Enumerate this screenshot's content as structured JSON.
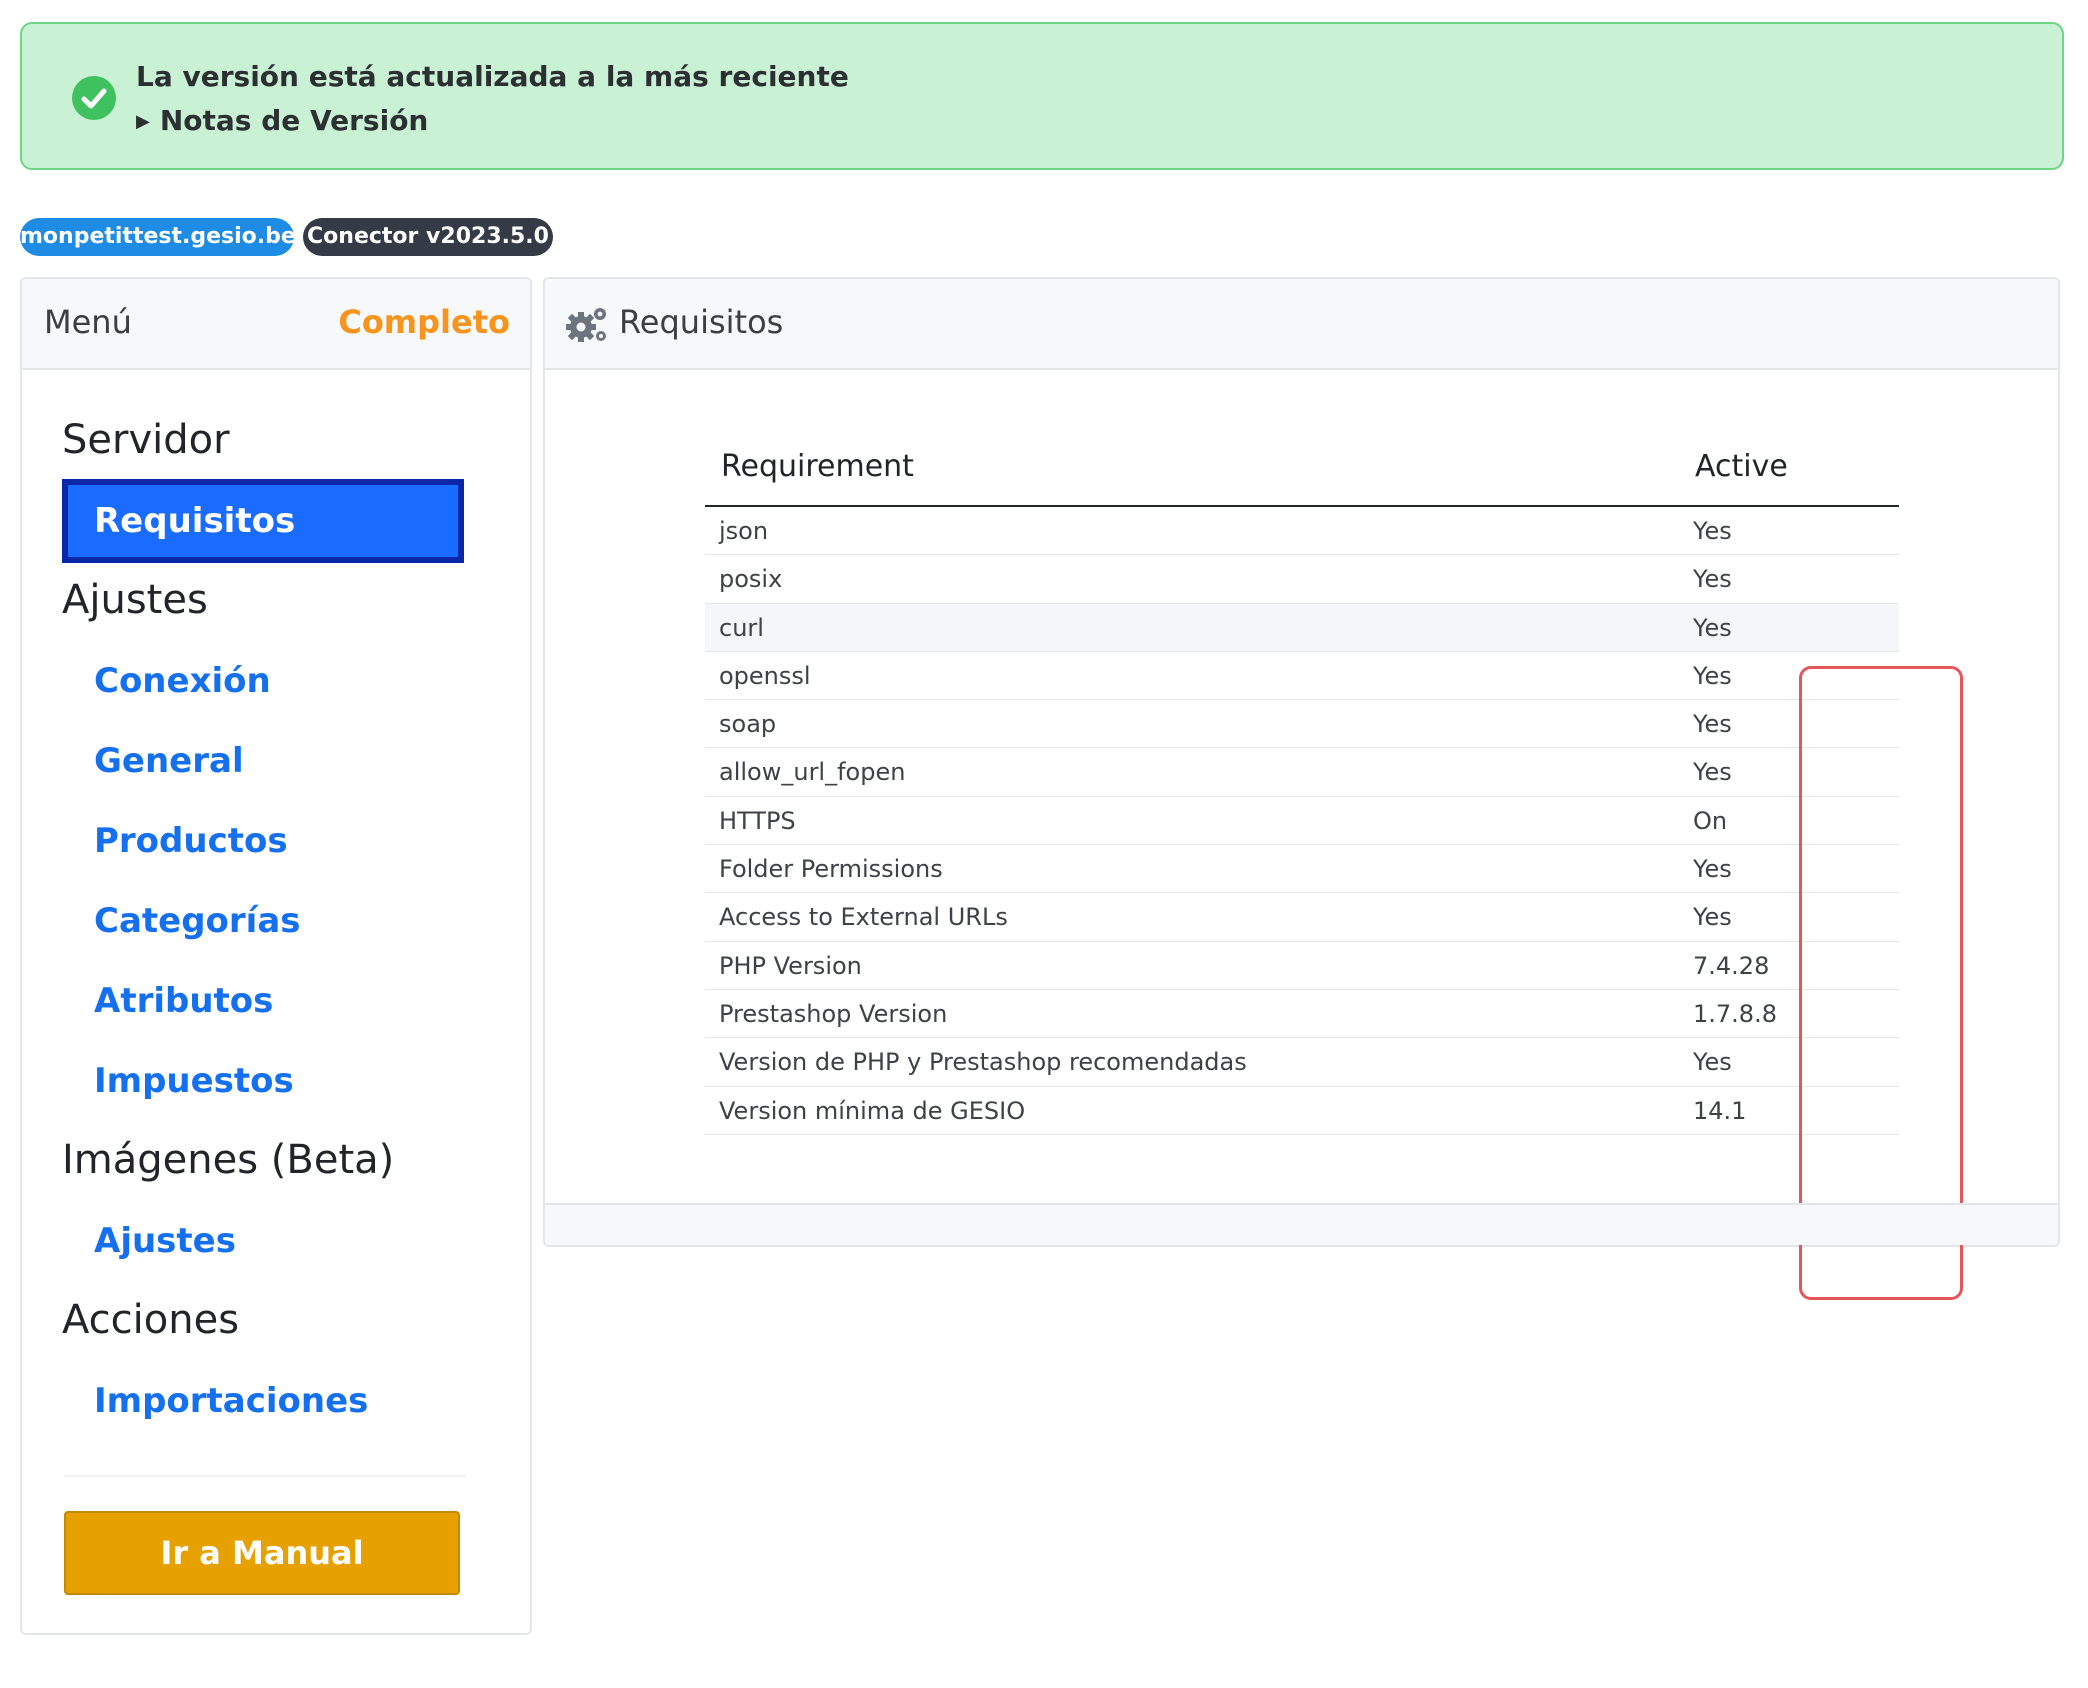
{
  "alert": {
    "message": "La versión está actualizada a la más reciente",
    "notes_label": "Notas de Versión",
    "color": "#c9f1d4"
  },
  "badges": {
    "site": "monpetittest.gesio.be",
    "version": "Conector v2023.5.0"
  },
  "sidebar": {
    "title": "Menú",
    "status": "Completo",
    "sections": {
      "servidor": "Servidor",
      "ajustes": "Ajustes",
      "imagenes": "Imágenes (Beta)",
      "acciones": "Acciones"
    },
    "items": {
      "requisitos": "Requisitos",
      "conexion": "Conexión",
      "general": "General",
      "productos": "Productos",
      "categorias": "Categorías",
      "atributos": "Atributos",
      "impuestos": "Impuestos",
      "img_ajustes": "Ajustes",
      "importaciones": "Importaciones"
    },
    "manual_button": "Ir a Manual"
  },
  "main": {
    "title": "Requisitos",
    "icon": "gears-icon",
    "table": {
      "headers": [
        "Requirement",
        "Active"
      ],
      "rows": [
        [
          "json",
          "Yes"
        ],
        [
          "posix",
          "Yes"
        ],
        [
          "curl",
          "Yes"
        ],
        [
          "openssl",
          "Yes"
        ],
        [
          "soap",
          "Yes"
        ],
        [
          "allow_url_fopen",
          "Yes"
        ],
        [
          "HTTPS",
          "On"
        ],
        [
          "Folder Permissions",
          "Yes"
        ],
        [
          "Access to External URLs",
          "Yes"
        ],
        [
          "PHP Version",
          "7.4.28"
        ],
        [
          "Prestashop Version",
          "1.7.8.8"
        ],
        [
          "Version de PHP y Prestashop recomendadas",
          "Yes"
        ],
        [
          "Version mínima de GESIO",
          "14.1"
        ]
      ]
    }
  },
  "colors": {
    "accent_blue": "#1570ef",
    "active_bg": "#1a6bff",
    "status_orange": "#f7941d",
    "manual_button": "#e6a100",
    "annotation_red": "#e4565c"
  }
}
